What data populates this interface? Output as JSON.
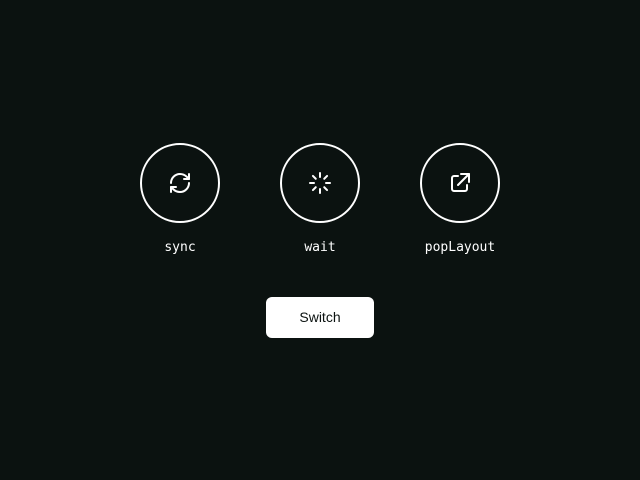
{
  "modes": [
    {
      "id": "sync",
      "label": "sync",
      "icon": "sync-icon"
    },
    {
      "id": "wait",
      "label": "wait",
      "icon": "spinner-icon"
    },
    {
      "id": "popLayout",
      "label": "popLayout",
      "icon": "external-link-icon"
    }
  ],
  "switch_button": {
    "label": "Switch"
  },
  "colors": {
    "background": "#0b1210",
    "foreground": "#ffffff"
  }
}
